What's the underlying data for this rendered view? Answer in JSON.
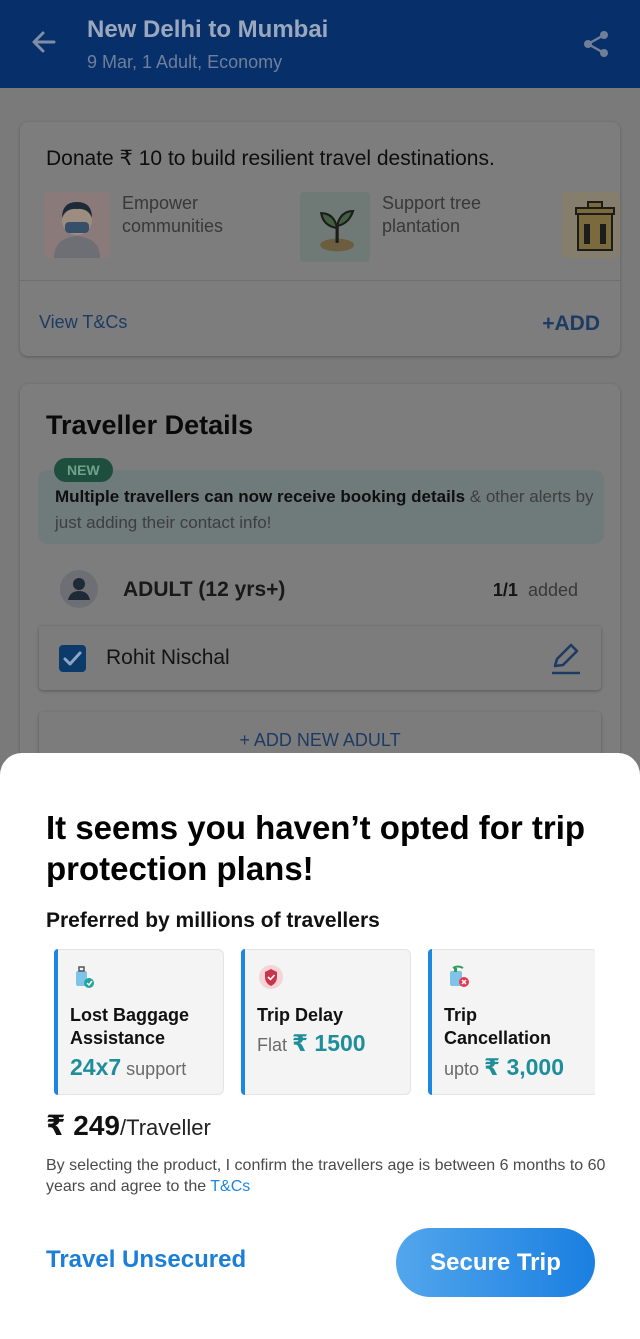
{
  "header": {
    "title": "New Delhi to Mumbai",
    "subtitle": "9 Mar, 1 Adult, Economy"
  },
  "donate": {
    "title": "Donate ₹ 10 to build resilient travel destinations.",
    "items": [
      {
        "label": "Empower communities",
        "icon": "person-mask-icon"
      },
      {
        "label": "Support tree plantation",
        "icon": "sapling-icon"
      }
    ],
    "view_tcs": "View T&Cs",
    "add_label": "+ADD"
  },
  "traveller": {
    "title": "Traveller Details",
    "new_badge": "NEW",
    "new_text_bold": "Multiple travellers can now receive booking details",
    "new_text_rest": " & other alerts by just adding their contact info!",
    "adult_label": "ADULT (12 yrs+)",
    "adult_count": "1/1",
    "adult_added": "added",
    "traveller_name": "Rohit Nischal",
    "add_adult": "+ ADD NEW ADULT"
  },
  "sheet": {
    "title": "It seems you haven’t opted for trip protection plans!",
    "subtitle": "Preferred by millions of travellers",
    "plans": [
      {
        "name": "Lost Baggage Assistance",
        "value_big": "24x7",
        "value_suffix": " support",
        "value_prefix": "",
        "icon": "luggage-icon"
      },
      {
        "name": "Trip Delay",
        "value_prefix": "Flat ",
        "value_big": "₹ 1500",
        "value_suffix": "",
        "icon": "shield-icon"
      },
      {
        "name": "Trip Cancellation",
        "value_prefix": "upto ",
        "value_big": "₹ 3,000",
        "value_suffix": "",
        "icon": "cancel-trip-icon"
      }
    ],
    "price": "₹ 249",
    "price_unit": "/Traveller",
    "disclaimer": "By selecting the product, I confirm the travellers age is between 6 months to 60 years and agree to the ",
    "disclaimer_link": "T&Cs",
    "btn_unsecured": "Travel Unsecured",
    "btn_secure": "Secure Trip"
  },
  "colors": {
    "header_bg": "#07306a",
    "accent_blue": "#1b87e3",
    "teal_value": "#1f8e9b"
  }
}
